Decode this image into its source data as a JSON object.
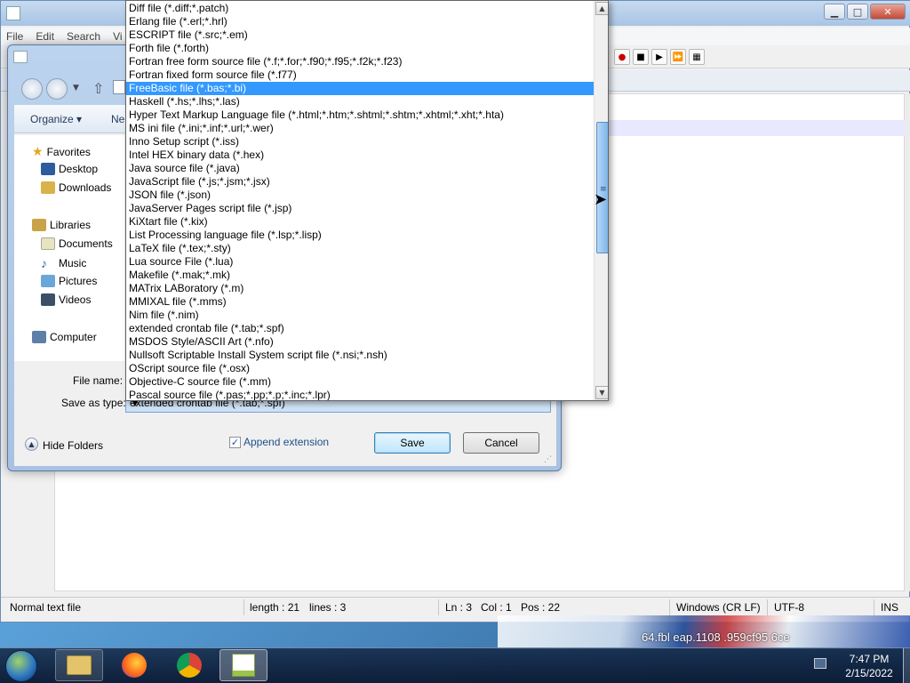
{
  "editor": {
    "menu": [
      "File",
      "Edit",
      "Search",
      "Vi"
    ],
    "status": {
      "file_type": "Normal text file",
      "length": "length : 21",
      "lines": "lines : 3",
      "ln": "Ln : 3",
      "col": "Col : 1",
      "pos": "Pos : 22",
      "eol": "Windows (CR LF)",
      "encoding": "UTF-8",
      "mode": "INS"
    }
  },
  "desktop": {
    "text": "64.fbl  eap.1108          .959cf95         6ce"
  },
  "dialog": {
    "organize_label": "Organize ▾",
    "new_label": "Ne",
    "nav": {
      "favorites": "Favorites",
      "desktop": "Desktop",
      "downloads": "Downloads",
      "libraries": "Libraries",
      "documents": "Documents",
      "music": "Music",
      "pictures": "Pictures",
      "videos": "Videos",
      "computer": "Computer"
    },
    "file_name_label": "File name:",
    "save_as_type_label": "Save as type:",
    "save_as_type_value": "extended crontab file (*.tab;*.spf)",
    "hide_folders_label": "Hide Folders",
    "append_extension_label": "Append extension",
    "append_extension_checked": true,
    "save_label": "Save",
    "cancel_label": "Cancel"
  },
  "dropdown": {
    "selected_index": 6,
    "options": [
      "Diff file (*.diff;*.patch)",
      "Erlang file (*.erl;*.hrl)",
      "ESCRIPT file (*.src;*.em)",
      "Forth file (*.forth)",
      "Fortran free form source file (*.f;*.for;*.f90;*.f95;*.f2k;*.f23)",
      "Fortran fixed form source file (*.f77)",
      "FreeBasic file (*.bas;*.bi)",
      "Haskell (*.hs;*.lhs;*.las)",
      "Hyper Text Markup Language file (*.html;*.htm;*.shtml;*.shtm;*.xhtml;*.xht;*.hta)",
      "MS ini file (*.ini;*.inf;*.url;*.wer)",
      "Inno Setup script (*.iss)",
      "Intel HEX binary data (*.hex)",
      "Java source file (*.java)",
      "JavaScript file (*.js;*.jsm;*.jsx)",
      "JSON file (*.json)",
      "JavaServer Pages script file (*.jsp)",
      "KiXtart file (*.kix)",
      "List Processing language file (*.lsp;*.lisp)",
      "LaTeX file (*.tex;*.sty)",
      "Lua source File (*.lua)",
      "Makefile (*.mak;*.mk)",
      "MATrix LABoratory (*.m)",
      "MMIXAL file (*.mms)",
      "Nim file (*.nim)",
      "extended crontab file (*.tab;*.spf)",
      "MSDOS Style/ASCII Art (*.nfo)",
      "Nullsoft Scriptable Install System script file (*.nsi;*.nsh)",
      "OScript source file (*.osx)",
      "Objective-C source file (*.mm)",
      "Pascal source file (*.pas;*.pp;*.p;*.inc;*.lpr)"
    ]
  },
  "taskbar": {
    "time": "7:47 PM",
    "date": "2/15/2022",
    "apps": [
      "explorer-icon",
      "firefox-icon",
      "chrome-icon",
      "notepadpp-icon"
    ]
  }
}
